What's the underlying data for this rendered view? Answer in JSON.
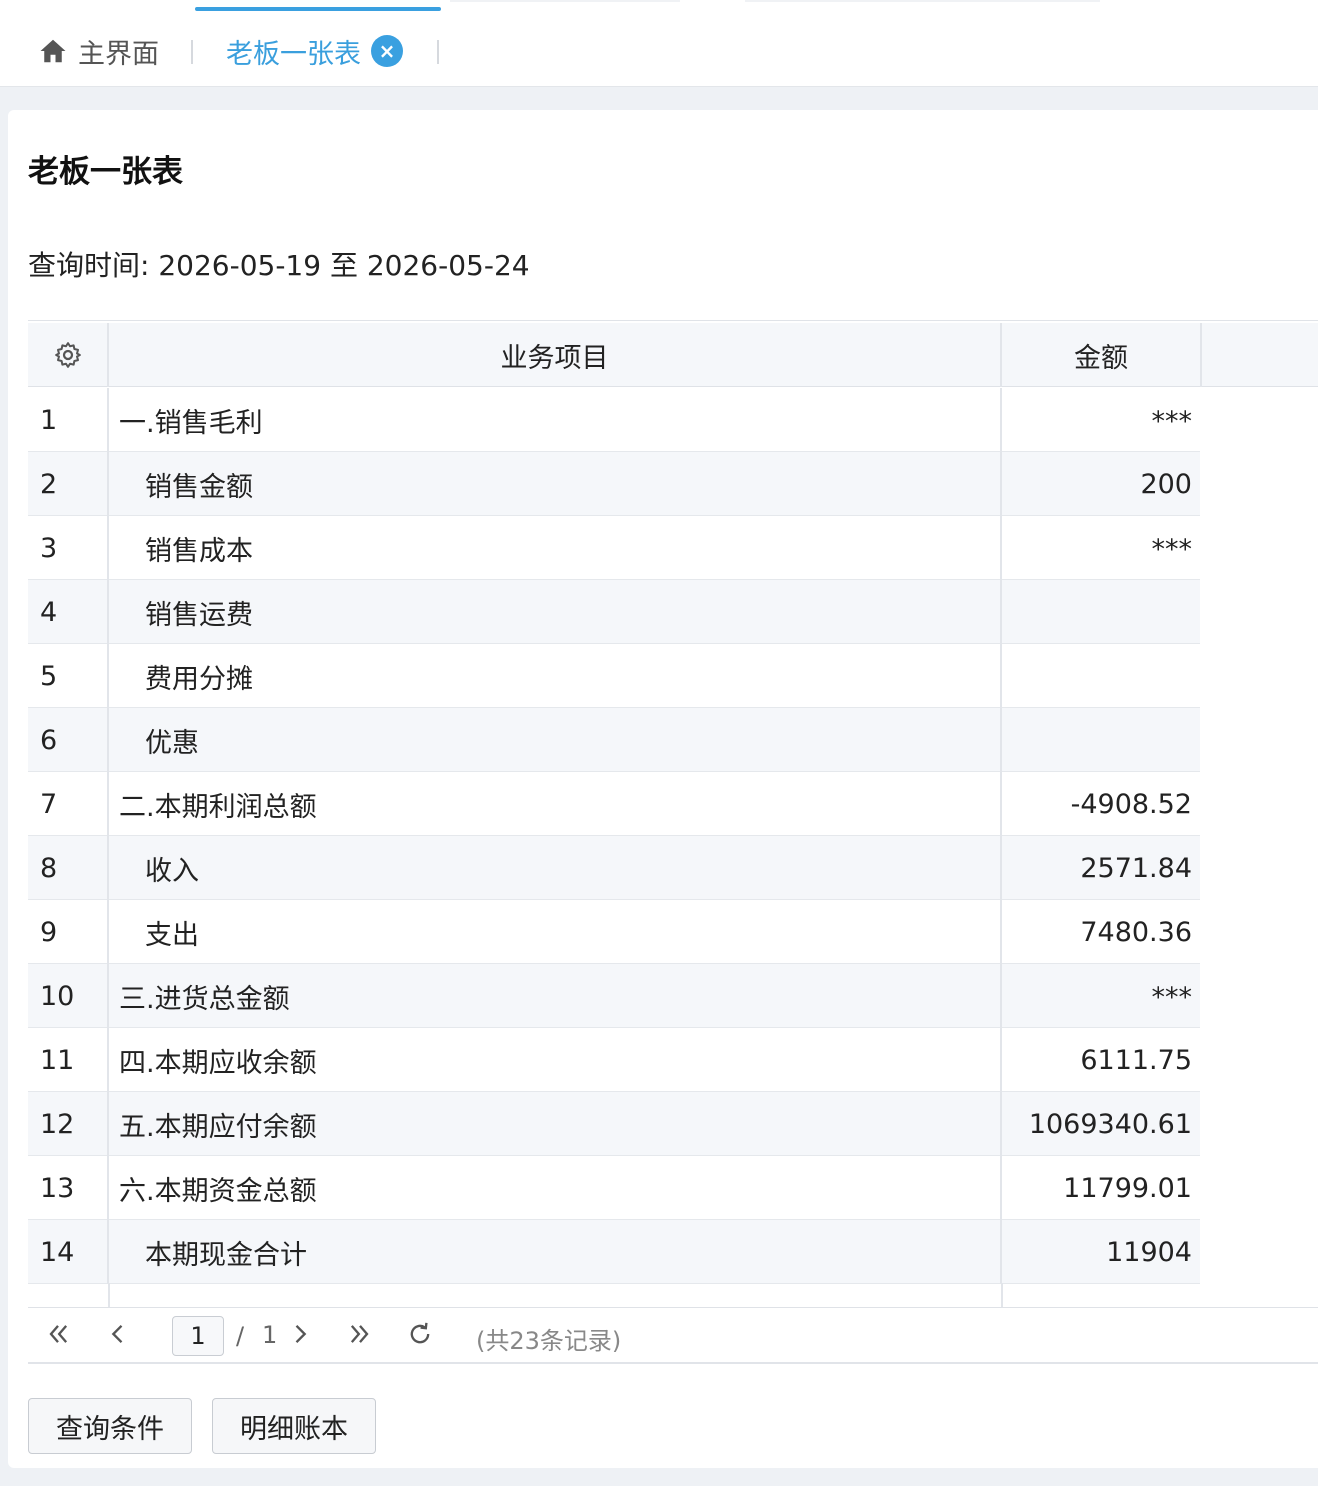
{
  "tabs": {
    "home_label": "主界面",
    "active_label": "老板一张表",
    "close_glyph": "×"
  },
  "page": {
    "title": "老板一张表",
    "query_time": "查询时间: 2026-05-19 至 2026-05-24"
  },
  "table": {
    "columns": {
      "item": "业务项目",
      "amount": "金额"
    },
    "rows": [
      {
        "idx": "1",
        "name": "一.销售毛利",
        "amount": "***"
      },
      {
        "idx": "2",
        "name": "销售金额",
        "amount": "200"
      },
      {
        "idx": "3",
        "name": "销售成本",
        "amount": "***"
      },
      {
        "idx": "4",
        "name": "销售运费",
        "amount": ""
      },
      {
        "idx": "5",
        "name": "费用分摊",
        "amount": ""
      },
      {
        "idx": "6",
        "name": "优惠",
        "amount": ""
      },
      {
        "idx": "7",
        "name": "二.本期利润总额",
        "amount": "-4908.52"
      },
      {
        "idx": "8",
        "name": "收入",
        "amount": "2571.84"
      },
      {
        "idx": "9",
        "name": "支出",
        "amount": "7480.36"
      },
      {
        "idx": "10",
        "name": "三.进货总金额",
        "amount": "***"
      },
      {
        "idx": "11",
        "name": "四.本期应收余额",
        "amount": "6111.75"
      },
      {
        "idx": "12",
        "name": "五.本期应付余额",
        "amount": "1069340.61"
      },
      {
        "idx": "13",
        "name": "六.本期资金总额",
        "amount": "11799.01"
      },
      {
        "idx": "14",
        "name": "本期现金合计",
        "amount": "11904"
      }
    ]
  },
  "pager": {
    "first": "«",
    "prev": "‹",
    "current_page": "1",
    "slash": "/",
    "total_pages": "1",
    "next": "›",
    "last": "»",
    "records": "(共23条记录)"
  },
  "buttons": {
    "query": "查询条件",
    "detail": "明细账本"
  },
  "colors": {
    "accent": "#3aa0e0",
    "row_alt": "#f5f7fa"
  }
}
